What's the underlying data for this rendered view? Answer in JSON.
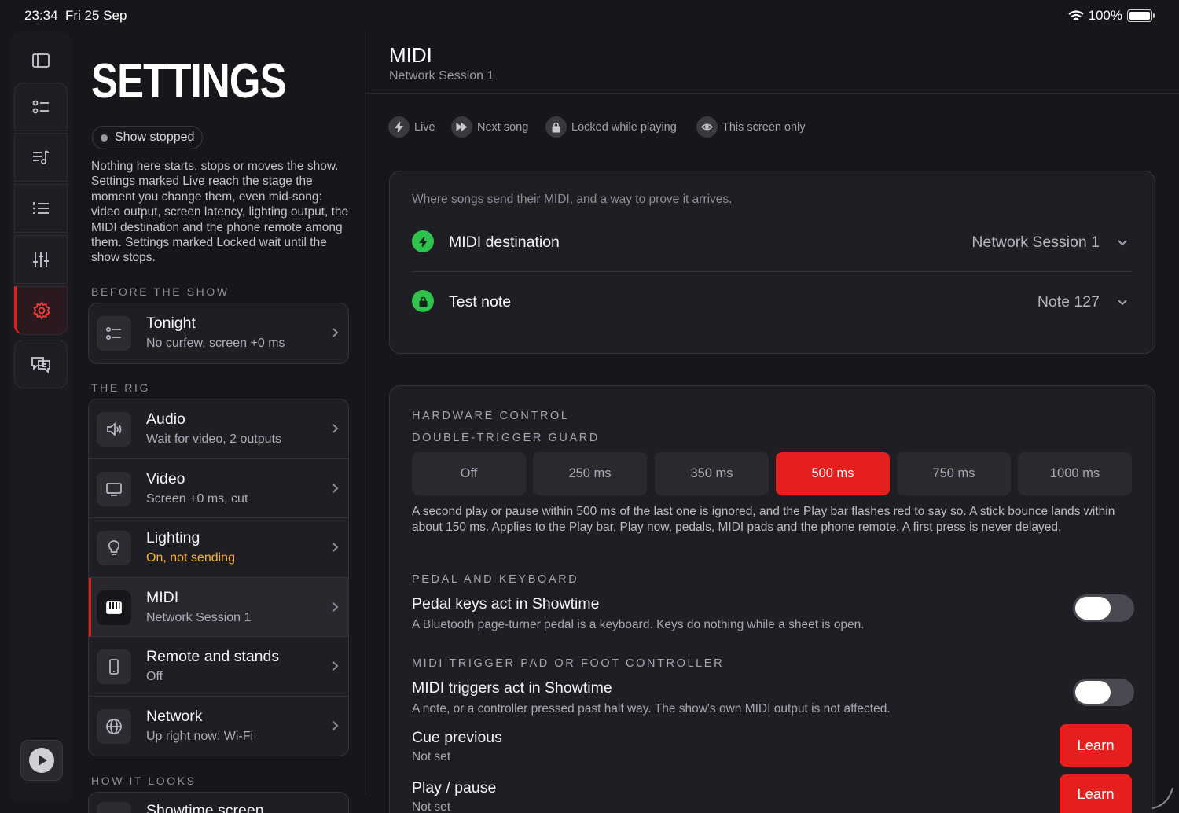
{
  "status": {
    "time": "23:34",
    "date": "Fri 25 Sep",
    "battery": "100%"
  },
  "rail": {
    "items": [
      {
        "name": "sidebar-toggle-icon"
      },
      {
        "name": "checklist-icon"
      },
      {
        "name": "music-list-icon"
      },
      {
        "name": "numbered-list-icon"
      },
      {
        "name": "sliders-icon"
      },
      {
        "name": "gear-icon",
        "active": true
      },
      {
        "name": "chat-icon"
      }
    ]
  },
  "sidebar": {
    "title": "SETTINGS",
    "show_status": "Show stopped",
    "intro": "Nothing here starts, stops or moves the show. Settings marked Live reach the stage the moment you change them, even mid-song: video output, screen latency, lighting output, the MIDI destination and the phone remote among them. Settings marked Locked wait until the show stops.",
    "sections": [
      {
        "label": "BEFORE THE SHOW",
        "items": [
          {
            "title": "Tonight",
            "subtitle": "No curfew, screen +0 ms"
          }
        ]
      },
      {
        "label": "THE RIG",
        "items": [
          {
            "title": "Audio",
            "subtitle": "Wait for video, 2 outputs"
          },
          {
            "title": "Video",
            "subtitle": "Screen +0 ms, cut"
          },
          {
            "title": "Lighting",
            "subtitle": "On, not sending"
          },
          {
            "title": "MIDI",
            "subtitle": "Network Session 1"
          },
          {
            "title": "Remote and stands",
            "subtitle": "Off"
          },
          {
            "title": "Network",
            "subtitle": "Up right now: Wi-Fi"
          }
        ]
      },
      {
        "label": "HOW IT LOOKS",
        "items": [
          {
            "title": "Showtime screen"
          }
        ]
      }
    ]
  },
  "main": {
    "title": "MIDI",
    "subtitle": "Network Session 1",
    "legend": [
      "Live",
      "Next song",
      "Locked while playing",
      "This screen only"
    ],
    "destination_panel": {
      "description": "Where songs send their MIDI, and a way to prove it arrives.",
      "rows": [
        {
          "label": "MIDI destination",
          "value": "Network Session 1"
        },
        {
          "label": "Test note",
          "value": "Note 127"
        }
      ]
    },
    "hardware": {
      "heading": "HARDWARE CONTROL",
      "guard_label": "DOUBLE-TRIGGER GUARD",
      "options": [
        "Off",
        "250 ms",
        "350 ms",
        "500 ms",
        "750 ms",
        "1000 ms"
      ],
      "selected": "500 ms",
      "guard_help": "A second play or pause within 500 ms of the last one is ignored, and the Play bar flashes red to say so. A stick bounce lands within about 150 ms. Applies to the Play bar, Play now, pedals, MIDI pads and the phone remote. A first press is never delayed.",
      "pedal_label": "PEDAL AND KEYBOARD",
      "pedal_title": "Pedal keys act in Showtime",
      "pedal_help": "A Bluetooth page-turner pedal is a keyboard. Keys do nothing while a sheet is open.",
      "pad_label": "MIDI TRIGGER PAD OR FOOT CONTROLLER",
      "pad_title": "MIDI triggers act in Showtime",
      "pad_help": "A note, or a controller pressed past half way. The show's own MIDI output is not affected.",
      "mappings": [
        {
          "title": "Cue previous",
          "value": "Not set",
          "button": "Learn"
        },
        {
          "title": "Play / pause",
          "value": "Not set",
          "button": "Learn"
        }
      ]
    }
  }
}
